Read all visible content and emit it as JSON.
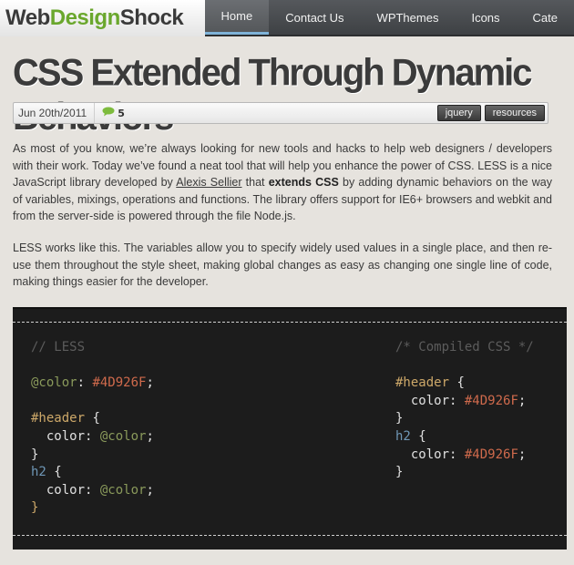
{
  "site": {
    "logo_part1": "Web",
    "logo_part2": "Design",
    "logo_part3": "Shock"
  },
  "nav": {
    "items": [
      {
        "label": "Home",
        "active": true
      },
      {
        "label": "Contact Us"
      },
      {
        "label": "WPThemes"
      },
      {
        "label": "Icons"
      },
      {
        "label": "Cate"
      }
    ]
  },
  "post": {
    "title": "CSS Extended Through Dynamic Behaviors",
    "date": "Jun 20th/2011",
    "comment_count": "5",
    "tags": [
      "jquery",
      "resources"
    ],
    "p1_a": "As most of you know, we’re always looking for new tools and hacks to help web designers / developers with their work. Today we’ve found a neat tool that will help you enhance the power of CSS. LESS is a nice JavaScript library developed by ",
    "p1_link": "Alexis Sellier",
    "p1_b": " that ",
    "p1_strong": "extends CSS",
    "p1_c": " by adding dynamic behaviors on the way of variables, mixings, operations and functions. The library offers support for IE6+ browsers and webkit and from the server-side is powered through the file Node.js.",
    "p2": "LESS works like this. The variables allow you to specify widely used values in a single place, and then re-use them throughout the style sheet, making global changes as easy as changing one single line of code, making things easier for the developer."
  },
  "code": {
    "left_comment": "// LESS",
    "right_comment": "/* Compiled CSS */",
    "var_name": "@color",
    "color_value": "#4D926F",
    "header_sel": "#header",
    "h2_sel": "h2",
    "prop": "color"
  },
  "colors": {
    "accent_green": "#6aa72d",
    "nav_active_underline": "#7fb3d8",
    "code_bg": "#1c1c1c"
  },
  "icons": {
    "comment": "speech-bubble-icon"
  }
}
